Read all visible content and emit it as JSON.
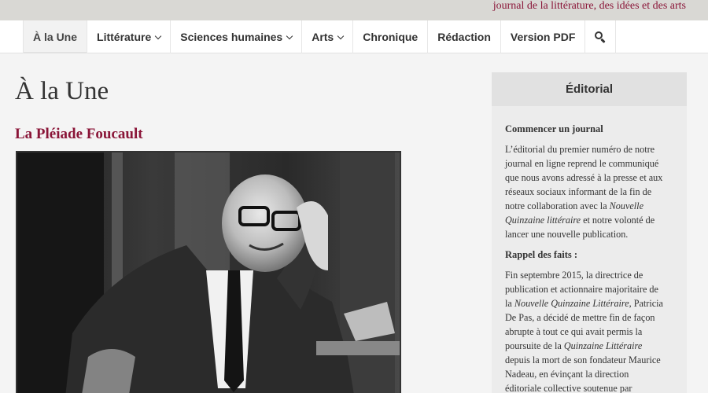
{
  "header": {
    "tagline": "journal de la littérature, des idées et des arts"
  },
  "nav": {
    "items": [
      {
        "label": "À la Une"
      },
      {
        "label": "Littérature"
      },
      {
        "label": "Sciences humaines"
      },
      {
        "label": "Arts"
      },
      {
        "label": "Chronique"
      },
      {
        "label": "Rédaction"
      },
      {
        "label": "Version PDF"
      }
    ],
    "search_icon": "search-icon"
  },
  "main": {
    "page_title": "À la Une",
    "article_title": "La Pléiade Foucault"
  },
  "sidebar": {
    "title": "Éditorial",
    "section1_title": "Commencer un journal",
    "para1_lines": [
      "L’éditorial du premier numéro de notre",
      "journal en ligne reprend le communiqué",
      "que nous avons adressé à la presse et aux",
      "réseaux sociaux informant de la fin de",
      "notre collaboration avec la ",
      "Nouvelle",
      "Quinzaine littéraire",
      " et notre volonté de",
      "lancer une nouvelle publication."
    ],
    "section2_title": "Rappel des faits :",
    "para2_lines": [
      "Fin septembre 2015, la directrice de",
      "publication et actionnaire majoritaire de",
      "la ",
      "Nouvelle Quinzaine Littéraire",
      ", Patricia",
      "De Pas, a décidé de mettre fin de façon",
      "abrupte à tout ce qui avait permis la",
      "poursuite de la ",
      "Quinzaine Littéraire",
      "depuis la mort de son fondateur Maurice",
      "Nadeau, en évinçant la direction",
      "éditoriale collective soutenue par"
    ]
  },
  "colors": {
    "accent": "#8a1538",
    "topbar": "#d9d8d4",
    "sidebar_bg": "#ececec"
  }
}
